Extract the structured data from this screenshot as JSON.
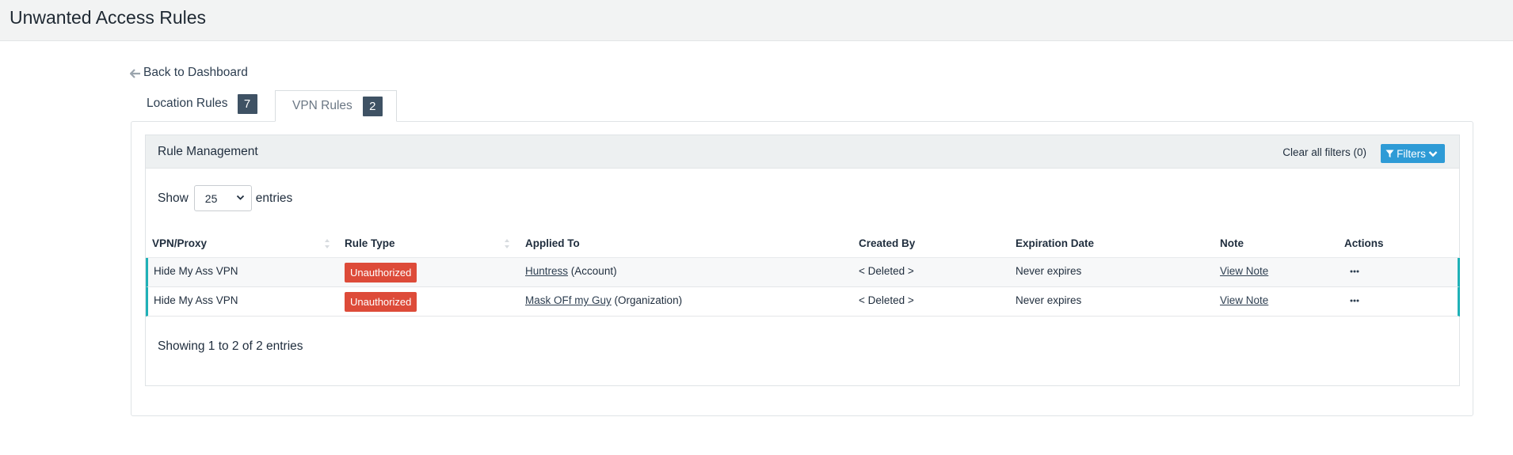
{
  "header": {
    "title": "Unwanted Access Rules"
  },
  "nav": {
    "back_label": "Back to Dashboard"
  },
  "tabs": [
    {
      "label": "Location Rules",
      "count": "7",
      "active": false
    },
    {
      "label": "VPN Rules",
      "count": "2",
      "active": true
    }
  ],
  "panel": {
    "title": "Rule Management",
    "clear_filters_label": "Clear all filters (0)",
    "filters_button_label": "Filters"
  },
  "length_menu": {
    "show_label": "Show",
    "selected": "25",
    "entries_label": "entries"
  },
  "table": {
    "columns": [
      "VPN/Proxy",
      "Rule Type",
      "Applied To",
      "Created By",
      "Expiration Date",
      "Note",
      "Actions"
    ],
    "rows": [
      {
        "vpn": "Hide My Ass VPN",
        "rule_type": "Unauthorized",
        "applied_link": "Huntress",
        "applied_suffix": "(Account)",
        "created_by": "< Deleted >",
        "expiration": "Never expires",
        "note": "View Note"
      },
      {
        "vpn": "Hide My Ass VPN",
        "rule_type": "Unauthorized",
        "applied_link": "Mask OFf my Guy",
        "applied_suffix": "(Organization)",
        "created_by": "< Deleted >",
        "expiration": "Never expires",
        "note": "View Note"
      }
    ]
  },
  "info": "Showing 1 to 2 of 2 entries",
  "colors": {
    "badge_red": "#dd4b39",
    "filters_blue": "#2e9bd6",
    "row_accent": "#1fb1b7",
    "count_badge": "#3f5264"
  },
  "icons": {
    "back": "arrow-left-icon",
    "filter": "funnel-icon",
    "dropdown": "chevron-down-icon",
    "sort": "sort-icon",
    "actions": "ellipsis-icon"
  }
}
